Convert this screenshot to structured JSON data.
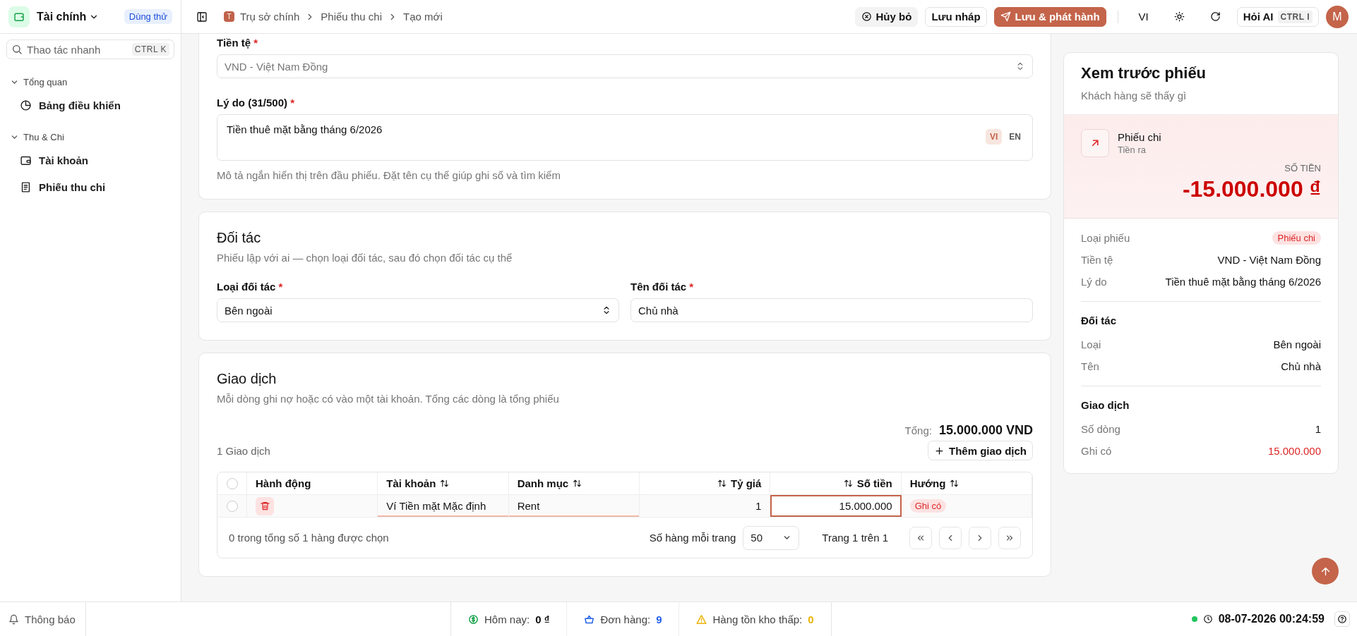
{
  "app": {
    "name": "Tài chính",
    "badge": "Dùng thử"
  },
  "quick_search": {
    "placeholder": "Thao tác nhanh",
    "shortcut": "CTRL K"
  },
  "sidebar": {
    "groups": [
      {
        "label": "Tổng quan",
        "expanded": true,
        "items": [
          {
            "label": "Bảng điều khiển",
            "kind": "chart",
            "selected": false
          }
        ]
      },
      {
        "label": "Thu & Chi",
        "expanded": true,
        "items": [
          {
            "label": "Tài khoản",
            "kind": "wallet",
            "selected": false
          },
          {
            "label": "Phiếu thu chi",
            "kind": "receipt",
            "selected": false
          }
        ]
      }
    ]
  },
  "breadcrumb": {
    "org_initial": "T",
    "items": [
      "Trụ sở chính",
      "Phiếu thu chi",
      "Tạo mới"
    ]
  },
  "toolbar": {
    "cancel": "Hủy bỏ",
    "draft": "Lưu nháp",
    "publish": "Lưu & phát hành",
    "language": "VI",
    "ask_ai": "Hỏi AI",
    "ask_ai_shortcut": "CTRL I",
    "avatar": "M"
  },
  "currency": {
    "label": "Tiền tệ",
    "required_mark": "*",
    "value": "VND - Việt Nam Đồng",
    "disabled": true
  },
  "reason": {
    "label": "Lý do (31/500)",
    "required_mark": "*",
    "value": "Tiền thuê mặt bằng tháng 6/2026",
    "languages": [
      {
        "label": "VI",
        "selected": true
      },
      {
        "label": "EN",
        "selected": false
      }
    ],
    "help": "Mô tả ngắn hiển thị trên đầu phiếu. Đặt tên cụ thể giúp ghi sổ và tìm kiếm"
  },
  "partner": {
    "title": "Đối tác",
    "subtitle": "Phiếu lập với ai — chọn loại đối tác, sau đó chọn đối tác cụ thể",
    "type": {
      "label": "Loại đối tác",
      "required_mark": "*",
      "value": "Bên ngoài"
    },
    "name": {
      "label": "Tên đối tác",
      "required_mark": "*",
      "value": "Chủ nhà"
    }
  },
  "transactions": {
    "title": "Giao dịch",
    "subtitle": "Mỗi dòng ghi nợ hoặc có vào một tài khoản. Tổng các dòng là tổng phiếu",
    "total_label": "Tổng:",
    "total": "15.000.000 VND",
    "count": "1 Giao dịch",
    "add_button": "Thêm giao dịch",
    "select_all_checked": false,
    "columns": [
      {
        "label": "Hành động",
        "sortable": false,
        "kind": "text"
      },
      {
        "label": "Tài khoản",
        "sortable": true,
        "kind": "text"
      },
      {
        "label": "Danh mục",
        "sortable": true,
        "kind": "text"
      },
      {
        "label": "Tỷ giá",
        "sortable": true,
        "kind": "numeric"
      },
      {
        "label": "Số tiền",
        "sortable": true,
        "kind": "numeric"
      },
      {
        "label": "Hướng",
        "sortable": true,
        "kind": "text"
      }
    ],
    "rows": [
      {
        "checked": false,
        "cells": [
          {
            "kind": "action",
            "underlined": false,
            "focused": false
          },
          {
            "kind": "text",
            "value": "Ví Tiền mặt Mặc định",
            "underlined": true,
            "focused": false
          },
          {
            "kind": "text",
            "value": "Rent",
            "underlined": true,
            "focused": false
          },
          {
            "kind": "number",
            "value": "1",
            "underlined": false,
            "focused": false
          },
          {
            "kind": "number",
            "value": "15.000.000",
            "underlined": false,
            "focused": true
          },
          {
            "kind": "badge",
            "value": "Ghi có",
            "underlined": false,
            "focused": false
          }
        ]
      }
    ],
    "selection_status": "0 trong tổng số 1 hàng được chọn",
    "rows_per_page_label": "Số hàng mỗi trang",
    "rows_per_page": "50",
    "page_info": "Trang 1 trên 1"
  },
  "preview": {
    "title": "Xem trước phiếu",
    "subtitle": "Khách hàng sẽ thấy gì",
    "voucher_type": "Phiếu chi",
    "voucher_subtitle": "Tiền ra",
    "amount_label": "SỐ TIỀN",
    "amount": "-15.000.000 ₫",
    "sections": [
      {
        "rows": [
          {
            "label": "Loại phiếu",
            "value": "Phiếu chi",
            "kind": "badge"
          },
          {
            "label": "Tiền tệ",
            "value": "VND - Việt Nam Đồng",
            "kind": "text"
          },
          {
            "label": "Lý do",
            "value": "Tiền thuê mặt bằng tháng 6/2026",
            "kind": "text"
          }
        ]
      },
      {
        "title": "Đối tác",
        "rows": [
          {
            "label": "Loại",
            "value": "Bên ngoài",
            "kind": "text"
          },
          {
            "label": "Tên",
            "value": "Chủ nhà",
            "kind": "text"
          }
        ]
      },
      {
        "title": "Giao dịch",
        "rows": [
          {
            "label": "Số dòng",
            "value": "1",
            "kind": "text"
          },
          {
            "label": "Ghi có",
            "value": "15.000.000",
            "kind": "negative"
          }
        ]
      }
    ]
  },
  "status_bar": {
    "notifications": "Thông báo",
    "stats": [
      {
        "label": "Hôm nay:",
        "value": "0 ₫",
        "kind": "money",
        "color": "#16a34a"
      },
      {
        "label": "Đơn hàng:",
        "value": "9",
        "kind": "orders",
        "color": "#2563eb"
      },
      {
        "label": "Hàng tồn kho thấp:",
        "value": "0",
        "kind": "stock",
        "color": "#eab308"
      }
    ],
    "online": true,
    "clock": "08-07-2026 00:24:59"
  }
}
